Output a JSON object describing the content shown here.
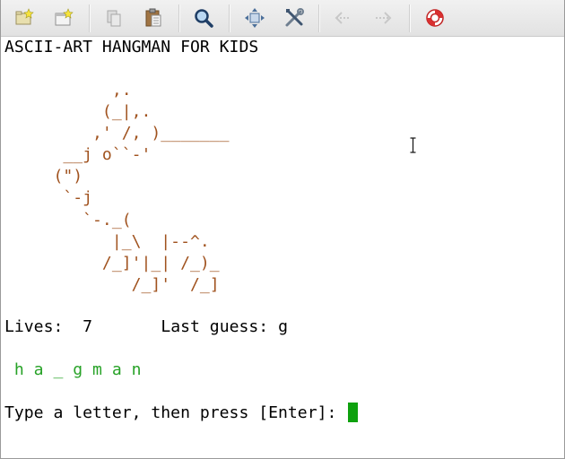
{
  "colors": {
    "text": "#000000",
    "art": "#a0521e",
    "word": "#27a227",
    "cursor": "#0ea10e"
  },
  "toolbar": {
    "buttons": [
      {
        "name": "new-tab-button",
        "icon": "folder-star-icon"
      },
      {
        "name": "new-window-button",
        "icon": "window-star-icon"
      },
      {
        "name": "copy-button",
        "icon": "copy-icon"
      },
      {
        "name": "paste-button",
        "icon": "paste-icon"
      },
      {
        "name": "find-button",
        "icon": "search-icon"
      },
      {
        "name": "fullscreen-button",
        "icon": "move-arrows-icon"
      },
      {
        "name": "preferences-button",
        "icon": "tools-icon"
      },
      {
        "name": "previous-tab-button",
        "icon": "back-arrow-icon"
      },
      {
        "name": "next-tab-button",
        "icon": "forward-arrow-icon"
      },
      {
        "name": "help-button",
        "icon": "lifebuoy-icon"
      }
    ]
  },
  "terminal": {
    "title": "ASCII-ART HANGMAN FOR KIDS",
    "art": "           ,.\n          (_|,.\n         ,' /, )_______\n      __j o``-'\n     (\")\n      `-j\n        `-._(\n           |_\\  |--^.\n          /_]'|_| /_)_\n             /_]'  /_]",
    "lives_label": "Lives:",
    "lives_value": "7",
    "last_guess_label": "Last guess:",
    "last_guess_value": "g",
    "word": " h a _ g m a n",
    "prompt": "Type a letter, then press [Enter]: "
  }
}
